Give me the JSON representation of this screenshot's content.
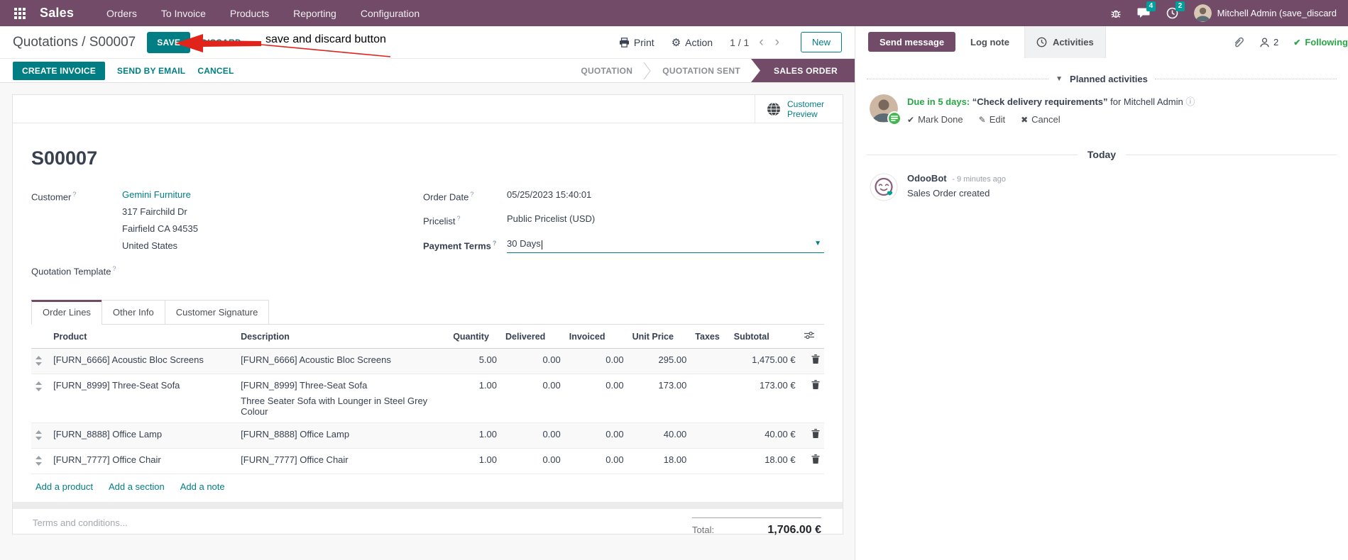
{
  "navbar": {
    "brand": "Sales",
    "items": [
      "Orders",
      "To Invoice",
      "Products",
      "Reporting",
      "Configuration"
    ],
    "message_badge": "4",
    "activity_badge": "2",
    "user": "Mitchell Admin (save_discard"
  },
  "control": {
    "breadcrumb": "Quotations / S00007",
    "save": "SAVE",
    "discard": "DISCARD",
    "print": "Print",
    "action": "Action",
    "pager": "1 / 1",
    "prev": "‹",
    "next": "›",
    "new": "New"
  },
  "annotation": {
    "text": "save and discard button"
  },
  "statusbar": {
    "create_invoice": "CREATE INVOICE",
    "send_by_email": "SEND BY EMAIL",
    "cancel": "CANCEL",
    "states": [
      "QUOTATION",
      "QUOTATION SENT",
      "SALES ORDER"
    ]
  },
  "sheet": {
    "customer_preview": "Customer Preview",
    "name": "S00007",
    "help": "?",
    "fields": {
      "customer_label": "Customer",
      "customer": "Gemini Furniture",
      "address_line1": "317 Fairchild Dr",
      "address_line2": "Fairfield CA 94535",
      "address_line3": "United States",
      "quotation_template_label": "Quotation Template",
      "order_date_label": "Order Date",
      "order_date": "05/25/2023 15:40:01",
      "pricelist_label": "Pricelist",
      "pricelist": "Public Pricelist (USD)",
      "payment_terms_label": "Payment Terms",
      "payment_terms": "30 Days"
    },
    "tabs": [
      "Order Lines",
      "Other Info",
      "Customer Signature"
    ],
    "table": {
      "headers": {
        "product": "Product",
        "description": "Description",
        "quantity": "Quantity",
        "delivered": "Delivered",
        "invoiced": "Invoiced",
        "unit_price": "Unit Price",
        "taxes": "Taxes",
        "subtotal": "Subtotal"
      },
      "rows": [
        {
          "product": "[FURN_6666] Acoustic Bloc Screens",
          "description": "[FURN_6666] Acoustic Bloc Screens",
          "quantity": "5.00",
          "delivered": "0.00",
          "invoiced": "0.00",
          "unit_price": "295.00",
          "subtotal": "1,475.00 €"
        },
        {
          "product": "[FURN_8999] Three-Seat Sofa",
          "description": "[FURN_8999] Three-Seat Sofa",
          "description2": "Three Seater Sofa with Lounger in Steel Grey Colour",
          "quantity": "1.00",
          "delivered": "0.00",
          "invoiced": "0.00",
          "unit_price": "173.00",
          "subtotal": "173.00 €"
        },
        {
          "product": "[FURN_8888] Office Lamp",
          "description": "[FURN_8888] Office Lamp",
          "quantity": "1.00",
          "delivered": "0.00",
          "invoiced": "0.00",
          "unit_price": "40.00",
          "subtotal": "40.00 €"
        },
        {
          "product": "[FURN_7777] Office Chair",
          "description": "[FURN_7777] Office Chair",
          "quantity": "1.00",
          "delivered": "0.00",
          "invoiced": "0.00",
          "unit_price": "18.00",
          "subtotal": "18.00 €"
        }
      ],
      "add_product": "Add a product",
      "add_section": "Add a section",
      "add_note": "Add a note",
      "terms_placeholder": "Terms and conditions...",
      "total_label": "Total:",
      "total": "1,706.00 €"
    }
  },
  "chatter": {
    "send_message": "Send message",
    "log_note": "Log note",
    "activities": "Activities",
    "followers_count": "2",
    "following": "Following",
    "planned": {
      "header": "Planned activities",
      "due": "Due in 5 days:",
      "summary": "“Check delivery requirements”",
      "assignee": "for Mitchell Admin",
      "mark_done": "Mark Done",
      "edit": "Edit",
      "cancel": "Cancel"
    },
    "today": "Today",
    "message": {
      "author": "OdooBot",
      "time": "- 9 minutes ago",
      "body": "Sales Order created"
    }
  },
  "colors": {
    "brand_purple": "#714B67",
    "primary_teal": "#017e84",
    "badge_teal": "#00a09d",
    "success_green": "#28a745",
    "annotation_red": "#e0241b"
  }
}
